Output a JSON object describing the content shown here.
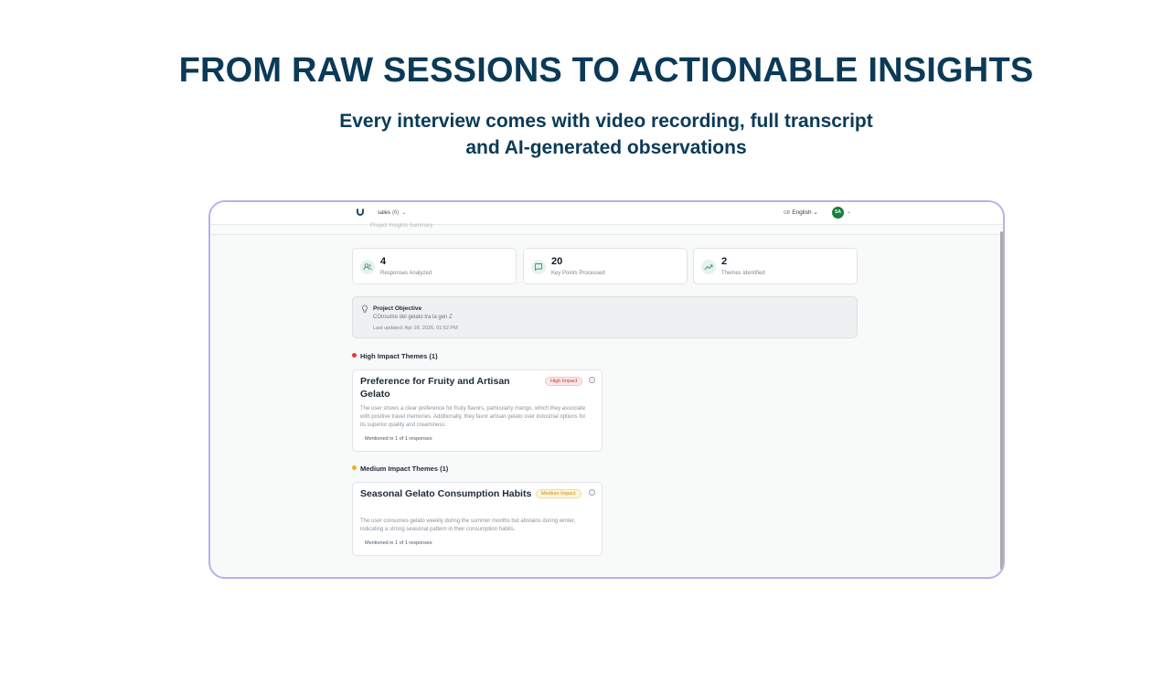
{
  "hero": {
    "title": "FROM RAW SESSIONS TO ACTIONABLE INSIGHTS",
    "subtitle_line1": "Every interview comes with video recording, full transcript",
    "subtitle_line2": "and AI-generated observations"
  },
  "app": {
    "topbar": {
      "workspace": "sales",
      "workspace_count": "(6)",
      "language_code": "GB",
      "language": "English",
      "avatar_initials": "SA"
    },
    "subbar_ghost": "Project Insights Summary",
    "stats": [
      {
        "value": "4",
        "label": "Responses Analyzed",
        "icon": "users-icon"
      },
      {
        "value": "20",
        "label": "Key Points Processed",
        "icon": "message-icon"
      },
      {
        "value": "2",
        "label": "Themes Identified",
        "icon": "trending-up-icon"
      }
    ],
    "objective": {
      "title": "Project Objective",
      "value": "COnsumo del gelato tra la gen Z",
      "updated": "Last updated: Apr 28, 2026, 01:52 PM"
    },
    "high_section": {
      "title": "High Impact Themes (1)",
      "color": "#e53935",
      "theme": {
        "title": "Preference for Fruity and Artisan Gelato",
        "badge": "High Impact",
        "description": "The user shows a clear preference for fruity flavors, particularly mango, which they associate with positive travel memories. Additionally, they favor artisan gelato over industrial options for its superior quality and creaminess.",
        "mentions": "Mentioned in 1 of 1 responses"
      }
    },
    "medium_section": {
      "title": "Medium Impact Themes (1)",
      "color": "#f2b01e",
      "theme": {
        "title": "Seasonal Gelato Consumption Habits",
        "badge": "Medium Impact",
        "description": "The user consumes gelato weekly during the summer months but abstains during winter, indicating a strong seasonal pattern in their consumption habits.",
        "mentions": "Mentioned in 1 of 1 responses"
      }
    }
  }
}
